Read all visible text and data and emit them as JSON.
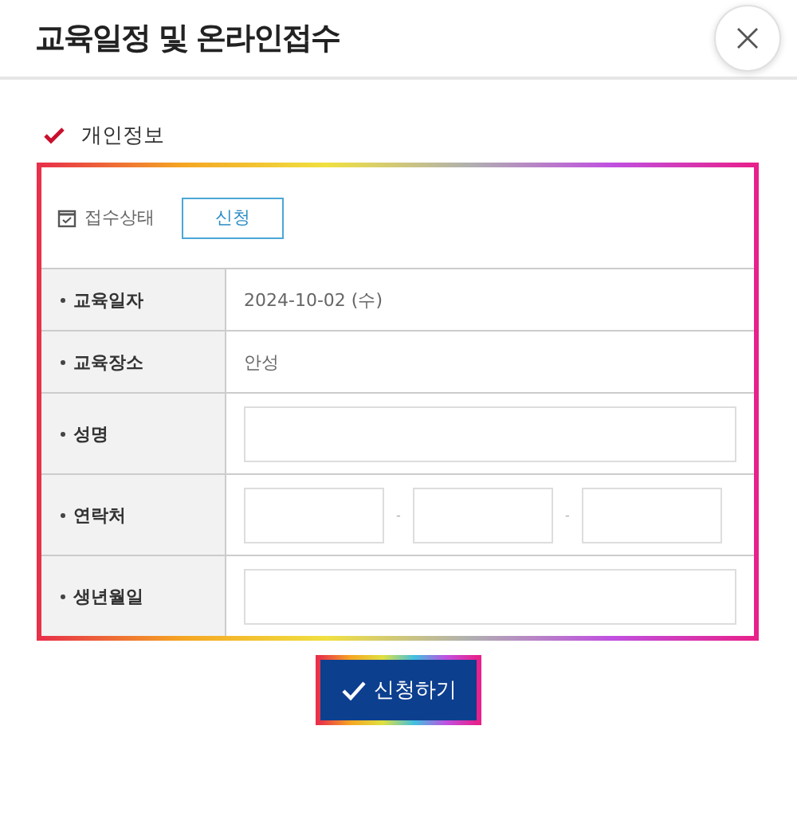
{
  "dialog": {
    "title": "교육일정 및 온라인접수"
  },
  "section": {
    "title": "개인정보"
  },
  "status": {
    "label": "접수상태",
    "value": "신청"
  },
  "rows": [
    {
      "label": "교육일자",
      "kind": "text",
      "value": "2024-10-02 (수)"
    },
    {
      "label": "교육장소",
      "kind": "text",
      "value": "안성"
    },
    {
      "label": "성명",
      "kind": "input"
    },
    {
      "label": "연락처",
      "kind": "phone",
      "separators": [
        "-",
        "-"
      ]
    },
    {
      "label": "생년월일",
      "kind": "input"
    }
  ],
  "submit_button": {
    "label": "신청하기"
  }
}
